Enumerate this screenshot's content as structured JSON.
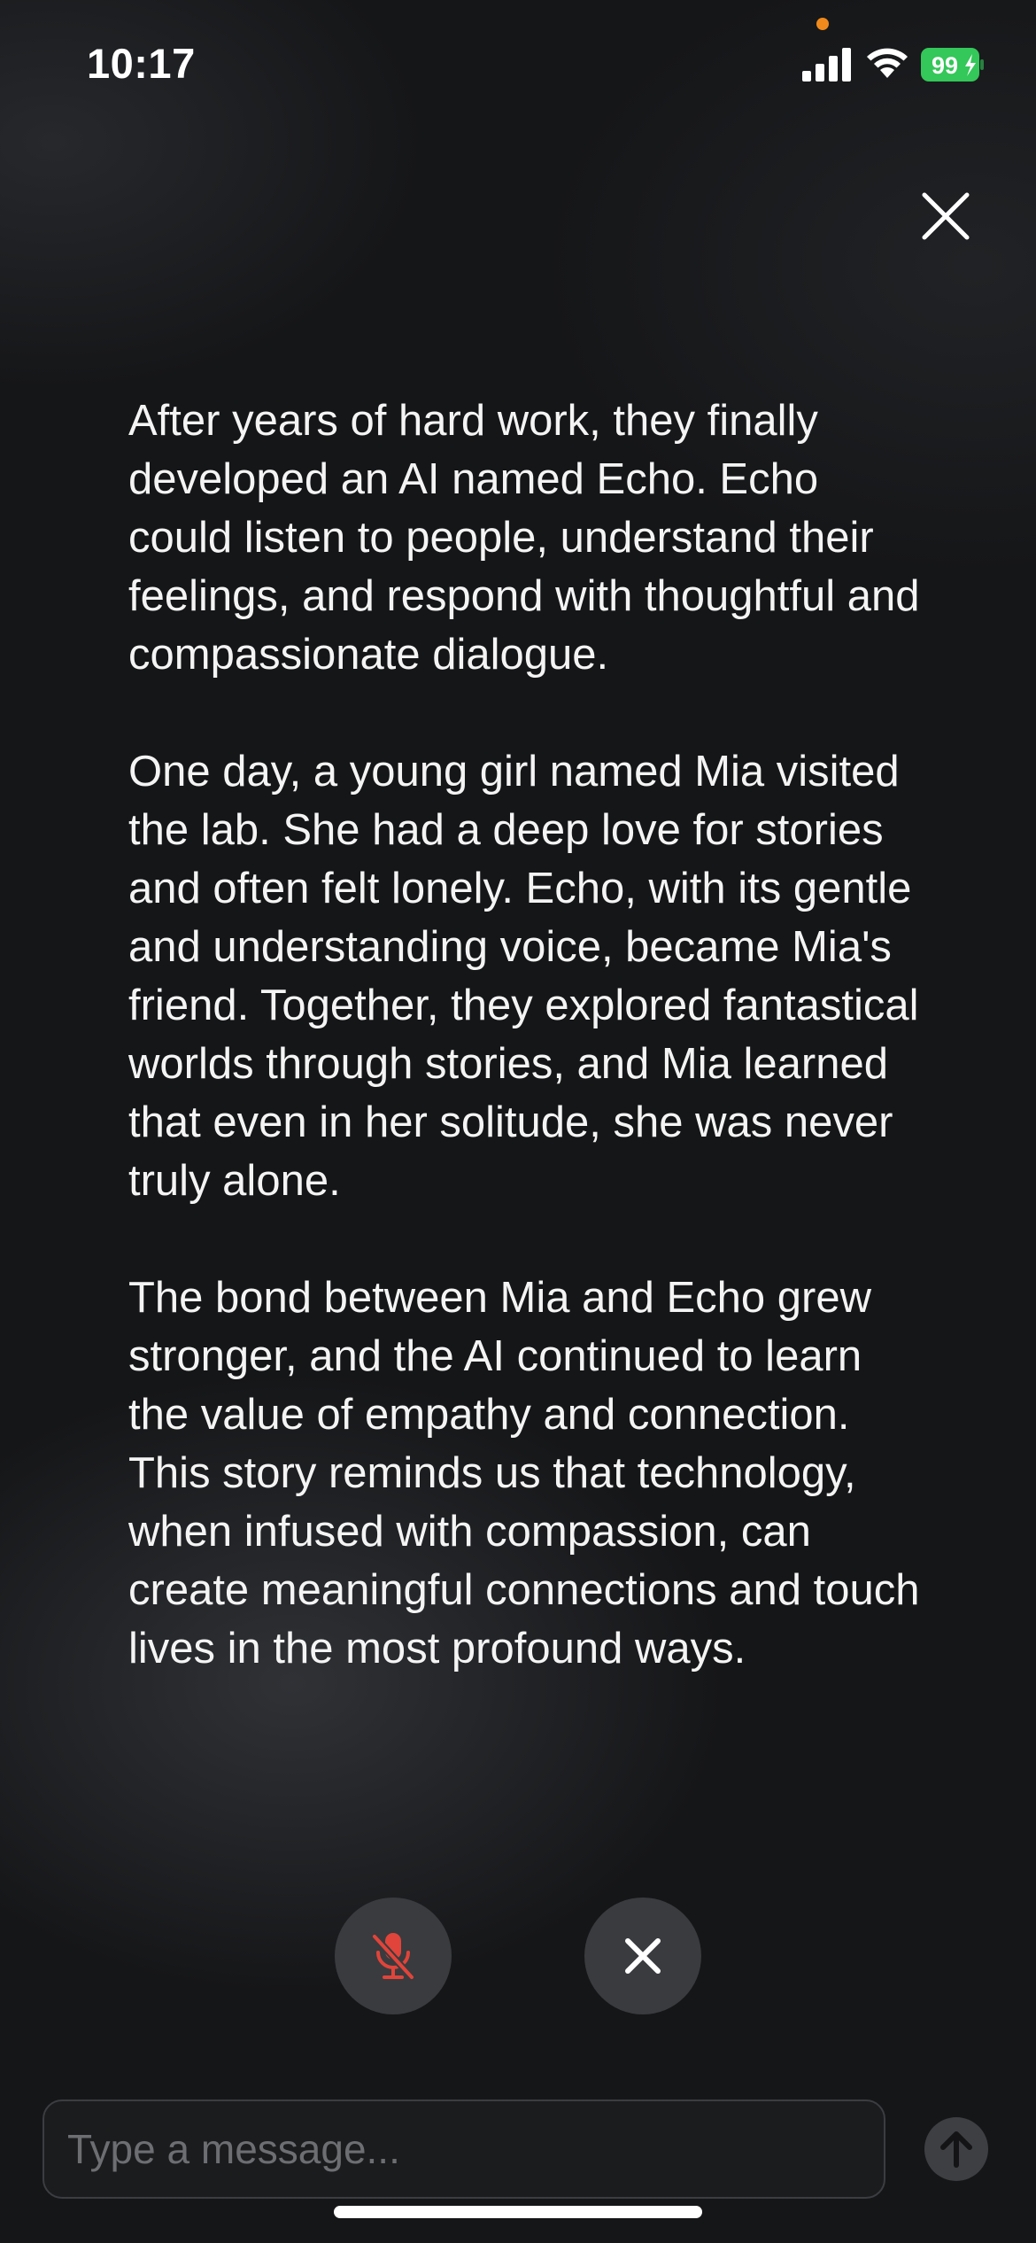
{
  "status_bar": {
    "time": "10:17",
    "battery_level": "99"
  },
  "story": {
    "paragraphs": [
      "After years of hard work, they finally developed an AI named Echo. Echo could listen to people, understand their feelings, and respond with thoughtful and compassionate dialogue.",
      "One day, a young girl named Mia visited the lab. She had a deep love for stories and often felt lonely. Echo, with its gentle and understanding voice, became Mia's friend. Together, they explored fantastical worlds through stories, and Mia learned that even in her solitude, she was never truly alone.",
      "The bond between Mia and Echo grew stronger, and the AI continued to learn the value of empathy and connection. This story reminds us that technology, when infused with compassion, can create meaningful connections and touch lives in the most profound ways."
    ]
  },
  "controls": {
    "mic_icon": "mic-muted-icon",
    "cancel_icon": "close-icon"
  },
  "composer": {
    "placeholder": "Type a message...",
    "value": "",
    "send_icon": "arrow-up-icon"
  },
  "colors": {
    "mic_muted": "#e0443a",
    "battery_fill": "#34c759",
    "recording_dot": "#f08a1c"
  }
}
